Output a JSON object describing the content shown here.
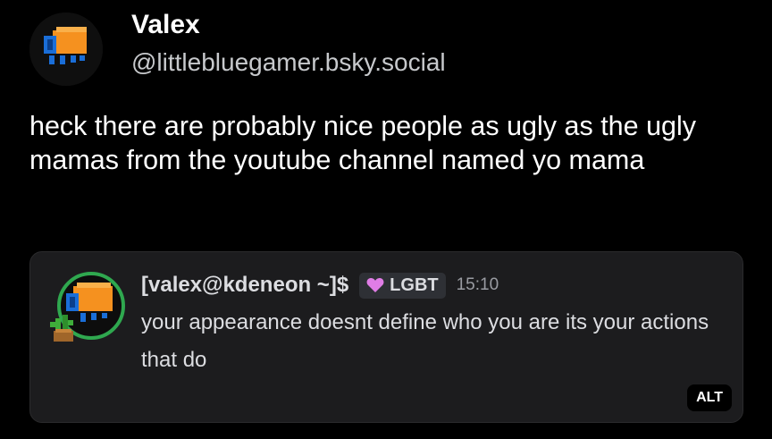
{
  "post": {
    "author": {
      "display_name": "Valex",
      "handle": "@littlebluegamer.bsky.social"
    },
    "text": "heck there are probably nice people as ugly as the ugly mamas from the youtube channel named yo mama"
  },
  "embed_image": {
    "username": "[valex@kdeneon ~]$",
    "role_tag": {
      "icon": "pink-heart-icon",
      "label": "LGBT",
      "color": "#e07de6"
    },
    "time": "15:10",
    "message": "your appearance doesnt define who you are its your actions that do",
    "alt_badge": "ALT"
  },
  "colors": {
    "background": "#000000",
    "embed_background": "#1c1c1e",
    "avatar_orange": "#f5911f",
    "avatar_blue": "#1a6ed8",
    "ring_green": "#2fa84f"
  }
}
